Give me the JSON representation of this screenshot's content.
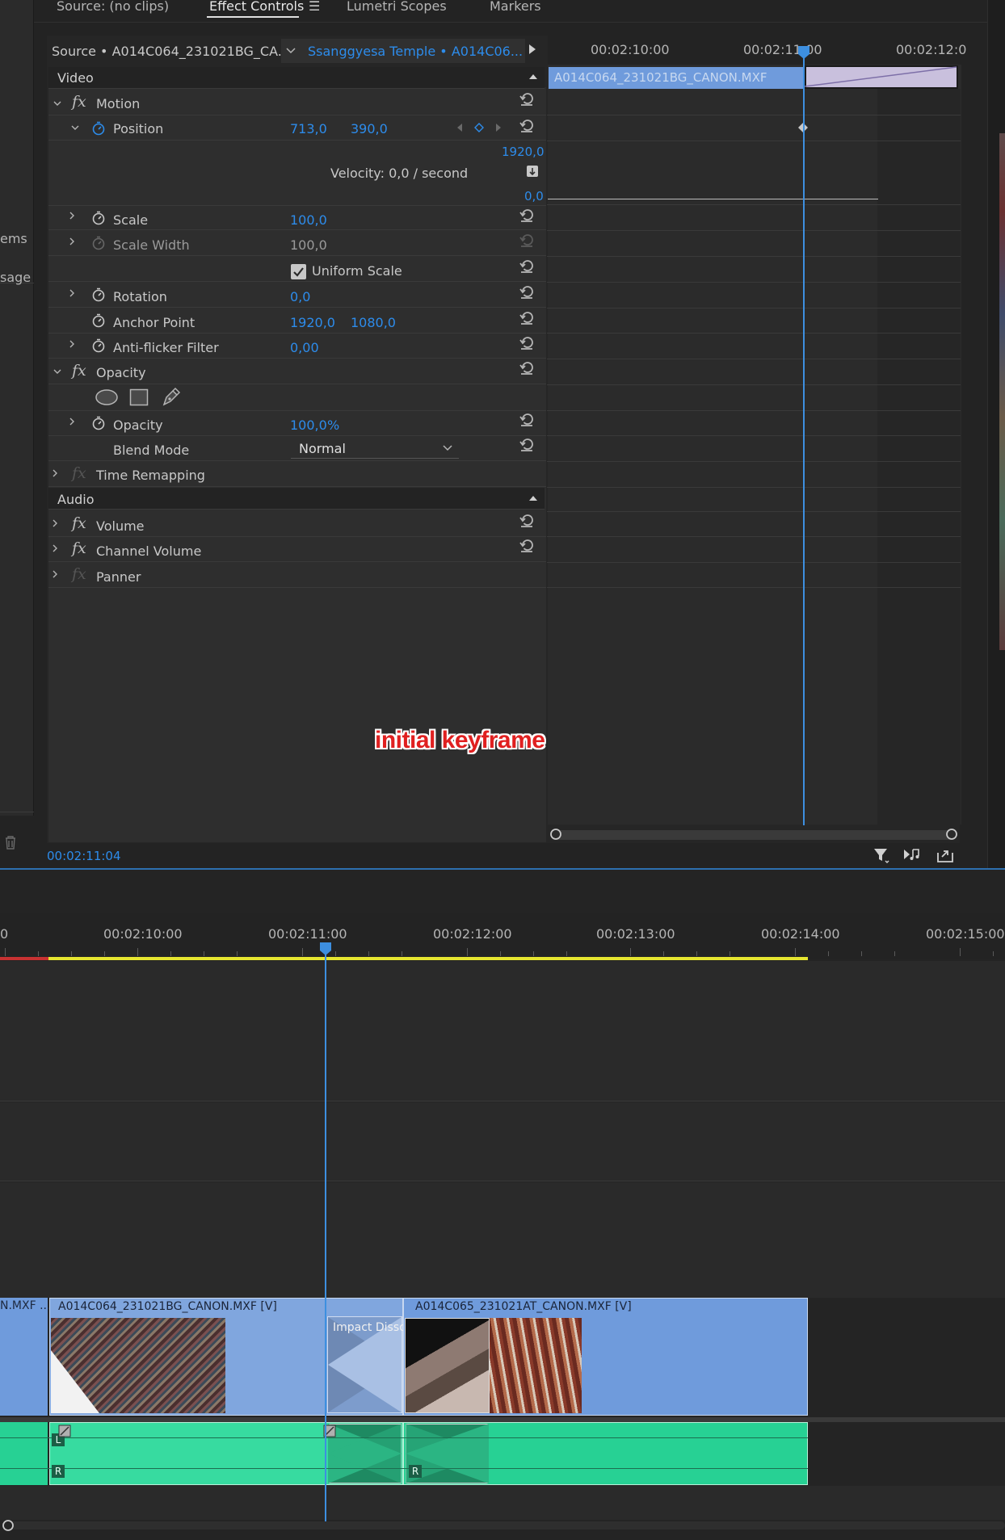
{
  "tabs": {
    "source": "Source: (no clips)",
    "effect_controls": "Effect Controls",
    "lumetri": "Lumetri Scopes",
    "markers": "Markers"
  },
  "left_edge": {
    "items_partial": "ems",
    "usage_partial": "sage"
  },
  "header": {
    "source_label": "Source • A014C064_231021BG_CA...",
    "sequence_label": "Ssanggyesa Temple • A014C06..."
  },
  "mini_timeline": {
    "ticks": [
      "00:02:10:00",
      "00:02:11:00",
      "00:02:12:0"
    ],
    "clip_name": "A014C064_231021BG_CANON.MXF",
    "graph_top": "1920,0",
    "graph_bottom": "0,0"
  },
  "sections": {
    "video": "Video",
    "audio": "Audio"
  },
  "motion": {
    "label": "Motion",
    "position": {
      "label": "Position",
      "x": "713,0",
      "y": "390,0"
    },
    "velocity": "Velocity: 0,0 / second",
    "scale": {
      "label": "Scale",
      "value": "100,0"
    },
    "scale_width": {
      "label": "Scale Width",
      "value": "100,0"
    },
    "uniform_scale": "Uniform Scale",
    "rotation": {
      "label": "Rotation",
      "value": "0,0"
    },
    "anchor": {
      "label": "Anchor Point",
      "x": "1920,0",
      "y": "1080,0"
    },
    "antiflicker": {
      "label": "Anti-flicker Filter",
      "value": "0,00"
    }
  },
  "opacity": {
    "label": "Opacity",
    "prop_label": "Opacity",
    "value": "100,0",
    "unit": "%",
    "blend_label": "Blend Mode",
    "blend_value": "Normal"
  },
  "time_remapping": "Time Remapping",
  "audio": {
    "volume": "Volume",
    "channel_volume": "Channel Volume",
    "panner": "Panner"
  },
  "annotation": "initial keyframe",
  "timecode": "00:02:11:04",
  "timeline": {
    "ticks": [
      "0",
      "00:02:10:00",
      "00:02:11:00",
      "00:02:12:00",
      "00:02:13:00",
      "00:02:14:00",
      "00:02:15:00"
    ],
    "clip_left_partial": "N.MXF ...",
    "clip1": "A014C064_231021BG_CANON.MXF [V]",
    "clip2": "A014C065_231021AT_CANON.MXF [V]",
    "transition": "Impact Dissolve",
    "audio_L": "L",
    "audio_R": "R"
  },
  "colors": {
    "accent": "#2d8ceb",
    "clip_video": "#7199d1",
    "clip_audio": "#27d194",
    "work_area": "#e6e630",
    "annotation": "#e02020"
  }
}
